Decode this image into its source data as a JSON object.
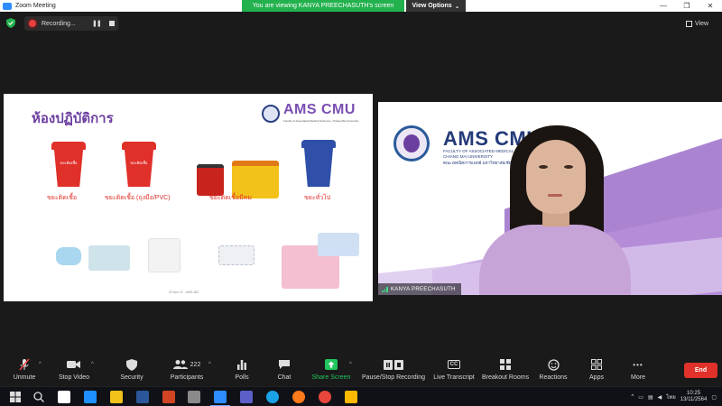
{
  "window": {
    "title": "Zoom Meeting",
    "share_banner": "You are viewing KANYA PREECHASUTH's screen",
    "view_options": "View Options",
    "view_options_caret": "⌄",
    "controls": {
      "minimize": "—",
      "maximize": "❐",
      "close": "✕"
    }
  },
  "recording": {
    "label": "Recording...",
    "pause": "❚❚"
  },
  "view_button": "View",
  "slide": {
    "title": "ห้องปฏิบัติการ",
    "logo_text": "AMS CMU",
    "logo_subtitle": "Faculty of Associated Medical Sciences, Chiang Mai University",
    "bins": [
      {
        "caption": "ขยะติดเชื้อ",
        "color": "#e0302a",
        "label": "ขยะติดเชื้อ"
      },
      {
        "caption": "ขยะติดเชื้อ (ถุงมือ/PVC)",
        "color": "#e0302a",
        "label": "ขยะติดเชื้อ"
      },
      {
        "caption": "ขยะติดเชื้อมีคม",
        "color": "#d8241e"
      },
      {
        "caption": "ขยะทั่วไป",
        "color": "#2f4fa8"
      }
    ],
    "footnote": "22 Nov 21 - AMS-IBC"
  },
  "speaker": {
    "name": "KANYA PREECHASUTH",
    "bg_logo": "AMS CMU",
    "bg_sub1": "FACULTY OF ASSOCIATED MEDICAL SCIENCES",
    "bg_sub2": "CHIANG MAI UNIVERSITY",
    "bg_sub3": "คณะเทคนิคการแพทย์ มหาวิทยาลัยเชียงใหม่"
  },
  "toolbar": {
    "unmute": "Unmute",
    "stop_video": "Stop Video",
    "security": "Security",
    "participants": "Participants",
    "participant_count": "222",
    "polls": "Polls",
    "chat": "Chat",
    "share_screen": "Share Screen",
    "pause_stop_recording": "Pause/Stop Recording",
    "live_transcript": "Live Transcript",
    "live_transcript_badge": "CC",
    "breakout_rooms": "Breakout Rooms",
    "reactions": "Reactions",
    "apps": "Apps",
    "more": "More",
    "more_icon": "•••",
    "end": "End",
    "caret": "^"
  },
  "taskbar": {
    "language": "ไทย",
    "time": "10:25",
    "date": "13/11/2564"
  }
}
